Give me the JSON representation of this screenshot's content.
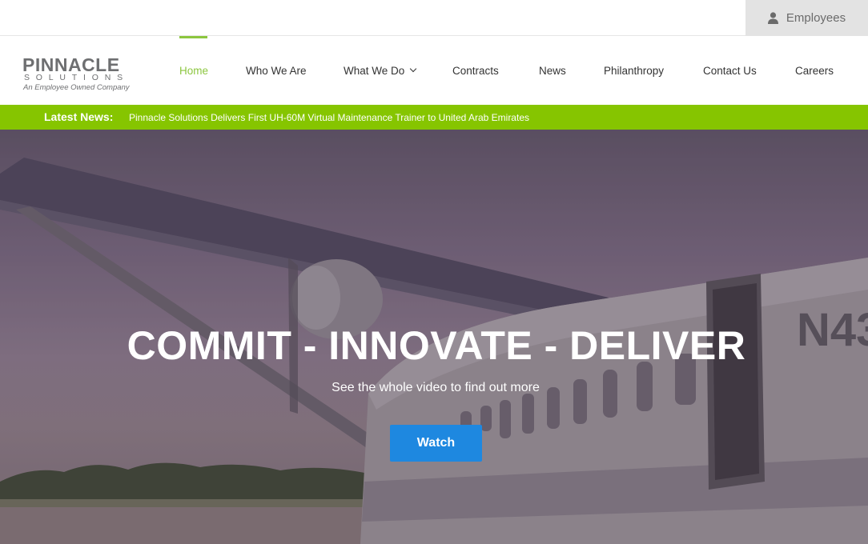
{
  "topbar": {
    "employees_label": "Employees"
  },
  "logo": {
    "brand": "PINNACLE",
    "sub": "SOLUTIONS",
    "tagline": "An Employee Owned Company"
  },
  "nav": {
    "items": [
      {
        "label": "Home",
        "active": true
      },
      {
        "label": "Who We Are"
      },
      {
        "label": "What We Do",
        "has_dropdown": true
      },
      {
        "label": "Contracts"
      },
      {
        "label": "News"
      },
      {
        "label": "Philanthropy"
      },
      {
        "label": "Contact Us"
      },
      {
        "label": "Careers"
      }
    ]
  },
  "ticker": {
    "label": "Latest News:",
    "headline": "Pinnacle Solutions Delivers First UH-60M Virtual Maintenance Trainer to United Arab Emirates"
  },
  "hero": {
    "title": "COMMIT - INNOVATE - DELIVER",
    "subtitle": "See the whole video to find out more",
    "button_label": "Watch",
    "tail_text": "N43"
  },
  "colors": {
    "accent_green": "#8cc63f",
    "ticker_green": "#86c500",
    "button_blue": "#1e88e0",
    "text_gray": "#6e6f71"
  },
  "icons": {
    "employees": "user-icon",
    "dropdown": "chevron-down-icon"
  }
}
